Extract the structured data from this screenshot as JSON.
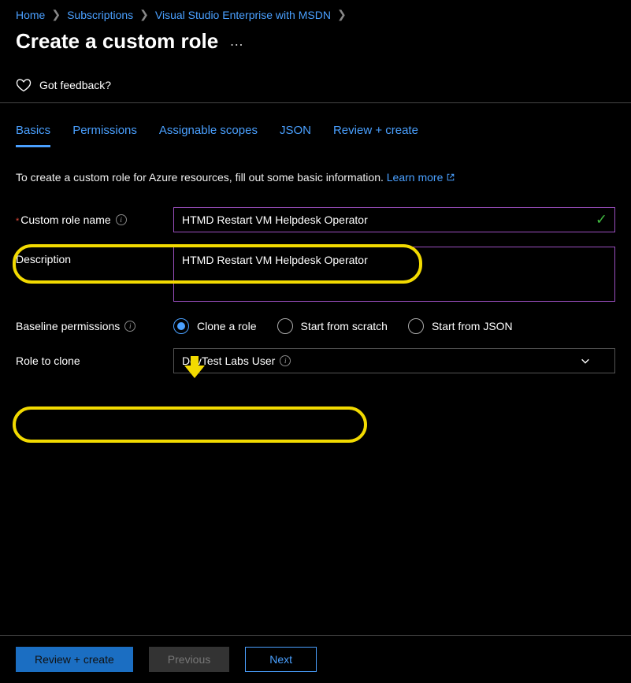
{
  "breadcrumb": {
    "home": "Home",
    "subscriptions": "Subscriptions",
    "subname": "Visual Studio Enterprise with MSDN"
  },
  "page_title": "Create a custom role",
  "more_label": "…",
  "feedback_text": "Got feedback?",
  "tabs": {
    "basics": "Basics",
    "permissions": "Permissions",
    "scopes": "Assignable scopes",
    "json": "JSON",
    "review": "Review + create"
  },
  "intro_text": "To create a custom role for Azure resources, fill out some basic information.",
  "learn_more": "Learn more",
  "form": {
    "name_label": "Custom role name",
    "name_value": "HTMD Restart VM Helpdesk Operator",
    "desc_label": "Description",
    "desc_value": "HTMD Restart VM Helpdesk Operator",
    "baseline_label": "Baseline permissions",
    "option_clone": "Clone a role",
    "option_scratch": "Start from scratch",
    "option_json": "Start from JSON",
    "clone_label": "Role to clone",
    "clone_value": "DevTest Labs User"
  },
  "footer": {
    "review": "Review + create",
    "previous": "Previous",
    "next": "Next"
  }
}
